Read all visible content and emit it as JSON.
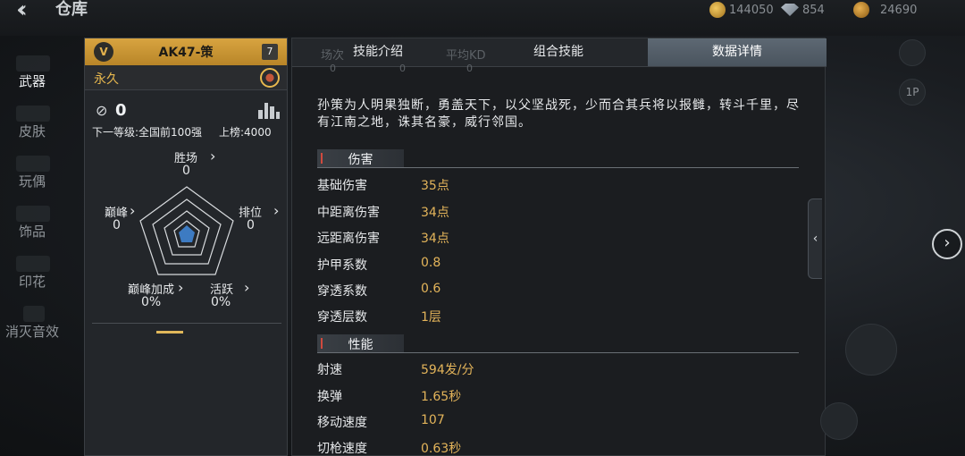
{
  "header": {
    "title": "仓库",
    "currencies": [
      {
        "icon": "gold-coin-icon",
        "value": "144050"
      },
      {
        "icon": "diamond-icon",
        "value": "854"
      },
      {
        "icon": "token-coin-icon",
        "value": "24690"
      }
    ]
  },
  "nav": {
    "items": [
      {
        "label": "武器",
        "active": true
      },
      {
        "label": "皮肤",
        "active": false
      },
      {
        "label": "玩偶",
        "active": false
      },
      {
        "label": "饰品",
        "active": false
      },
      {
        "label": "印花",
        "active": false
      },
      {
        "label": "消灭音效",
        "active": false
      }
    ]
  },
  "weapon": {
    "badge": "V",
    "name": "AK47-策",
    "level": "7",
    "duration": "永久",
    "rank": "0",
    "next_level": "下一等级:全国前100强",
    "board": "上榜:4000",
    "stats": {
      "wins": {
        "label": "胜场",
        "value": "0"
      },
      "rank_pos": {
        "label": "排位",
        "value": "0"
      },
      "peak": {
        "label": "巅峰",
        "value": "0"
      },
      "peak_bonus": {
        "label": "巅峰加成",
        "value": "0%"
      },
      "active": {
        "label": "活跃",
        "value": "0%"
      }
    }
  },
  "tabs": {
    "ghost_labels": [
      "场次",
      "平均KD"
    ],
    "ghost_values": [
      "0",
      "0",
      "0"
    ],
    "items": [
      {
        "label": "技能介绍",
        "active": false
      },
      {
        "label": "组合技能",
        "active": false
      },
      {
        "label": "数据详情",
        "active": true
      }
    ]
  },
  "detail": {
    "description": "孙策为人明果独断，勇盖天下，以父坚战死，少而合其兵将以报雠，转斗千里，尽有江南之地，诛其名豪，威行邻国。",
    "damage": {
      "title": "伤害",
      "rows": [
        {
          "label": "基础伤害",
          "value": "35点"
        },
        {
          "label": "中距离伤害",
          "value": "34点"
        },
        {
          "label": "远距离伤害",
          "value": "34点"
        },
        {
          "label": "护甲系数",
          "value": "0.8"
        },
        {
          "label": "穿透系数",
          "value": "0.6"
        },
        {
          "label": "穿透层数",
          "value": "1层"
        }
      ]
    },
    "performance": {
      "title": "性能",
      "rows": [
        {
          "label": "射速",
          "value": "594发/分"
        },
        {
          "label": "换弹",
          "value": "1.65秒"
        },
        {
          "label": "移动速度",
          "value": "107"
        },
        {
          "label": "切枪速度",
          "value": "0.63秒"
        }
      ]
    }
  },
  "side": {
    "view_label": "1P"
  }
}
